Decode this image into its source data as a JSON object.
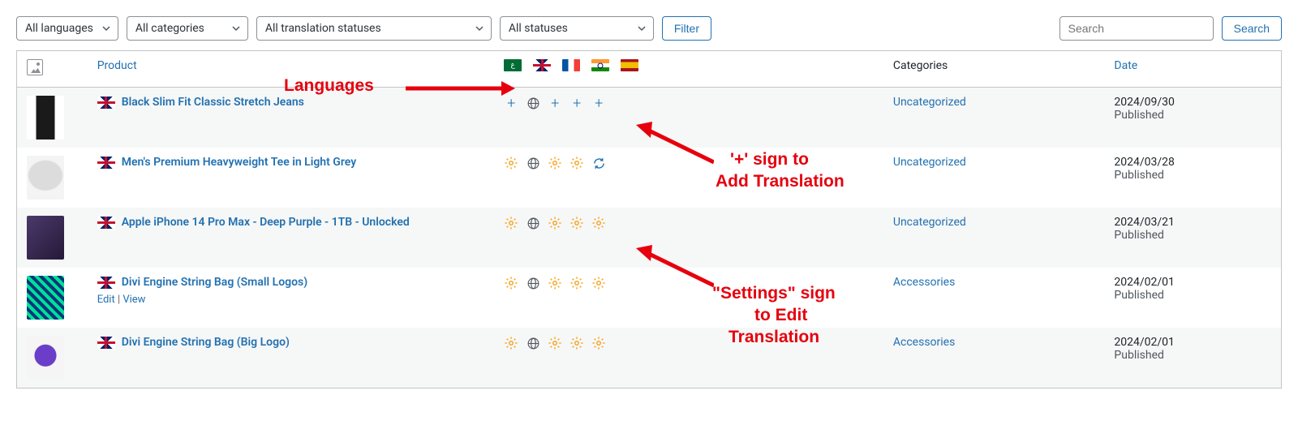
{
  "filters": {
    "languages": "All languages",
    "categories": "All categories",
    "translation_statuses": "All translation statuses",
    "statuses": "All statuses",
    "filter_btn": "Filter"
  },
  "search": {
    "placeholder": "Search",
    "button": "Search"
  },
  "headers": {
    "product": "Product",
    "categories": "Categories",
    "date": "Date"
  },
  "header_flags": [
    "sa",
    "uk",
    "fr",
    "in",
    "es"
  ],
  "rows": [
    {
      "flag": "uk",
      "title": "Black Slim Fit Classic Stretch Jeans",
      "status_icons": [
        "plus",
        "globe",
        "plus",
        "plus",
        "plus"
      ],
      "category": "Uncategorized",
      "date": "2024/09/30",
      "state": "Published",
      "thumb_bg": "linear-gradient(to right,#fff 25%,#1a1a1a 25% 75%,#fff 75%)"
    },
    {
      "flag": "uk",
      "title": "Men's Premium Heavyweight Tee in Light Grey",
      "status_icons": [
        "gear",
        "globe",
        "gear",
        "gear",
        "refresh"
      ],
      "category": "Uncategorized",
      "date": "2024/03/28",
      "state": "Published",
      "thumb_bg": "radial-gradient(ellipse 80% 60% at 50% 45%,#dcdcdc 55%,#f4f4f4 60%)"
    },
    {
      "flag": "uk",
      "title": "Apple iPhone 14 Pro Max - Deep Purple - 1TB - Unlocked",
      "status_icons": [
        "gear",
        "globe",
        "gear",
        "gear",
        "gear"
      ],
      "category": "Uncategorized",
      "date": "2024/03/21",
      "state": "Published",
      "thumb_bg": "linear-gradient(135deg,#4a3a6a,#251938)"
    },
    {
      "flag": "uk",
      "title": "Divi Engine String Bag (Small Logos)",
      "status_icons": [
        "gear",
        "globe",
        "gear",
        "gear",
        "gear"
      ],
      "category": "Accessories",
      "date": "2024/02/01",
      "state": "Published",
      "thumb_bg": "repeating-linear-gradient(45deg,#6a3ec9 0 4px,#fff 4px 8px), #00e09a",
      "thumb_blend": "multiply",
      "actions": {
        "edit": "Edit",
        "view": "View"
      }
    },
    {
      "flag": "uk",
      "title": "Divi Engine String Bag (Big Logo)",
      "status_icons": [
        "gear",
        "globe",
        "gear",
        "gear",
        "gear"
      ],
      "category": "Accessories",
      "date": "2024/02/01",
      "state": "Published",
      "thumb_bg": "radial-gradient(circle at 50% 45%,#6a3ec9 35%, #f5f5f5 37%), #00e09a"
    }
  ],
  "annotations": {
    "languages_label": "Languages",
    "plus_label_1": "'+' sign to",
    "plus_label_2": "Add Translation",
    "gear_label_1": "\"Settings\" sign",
    "gear_label_2": "to Edit",
    "gear_label_3": "Translation"
  }
}
